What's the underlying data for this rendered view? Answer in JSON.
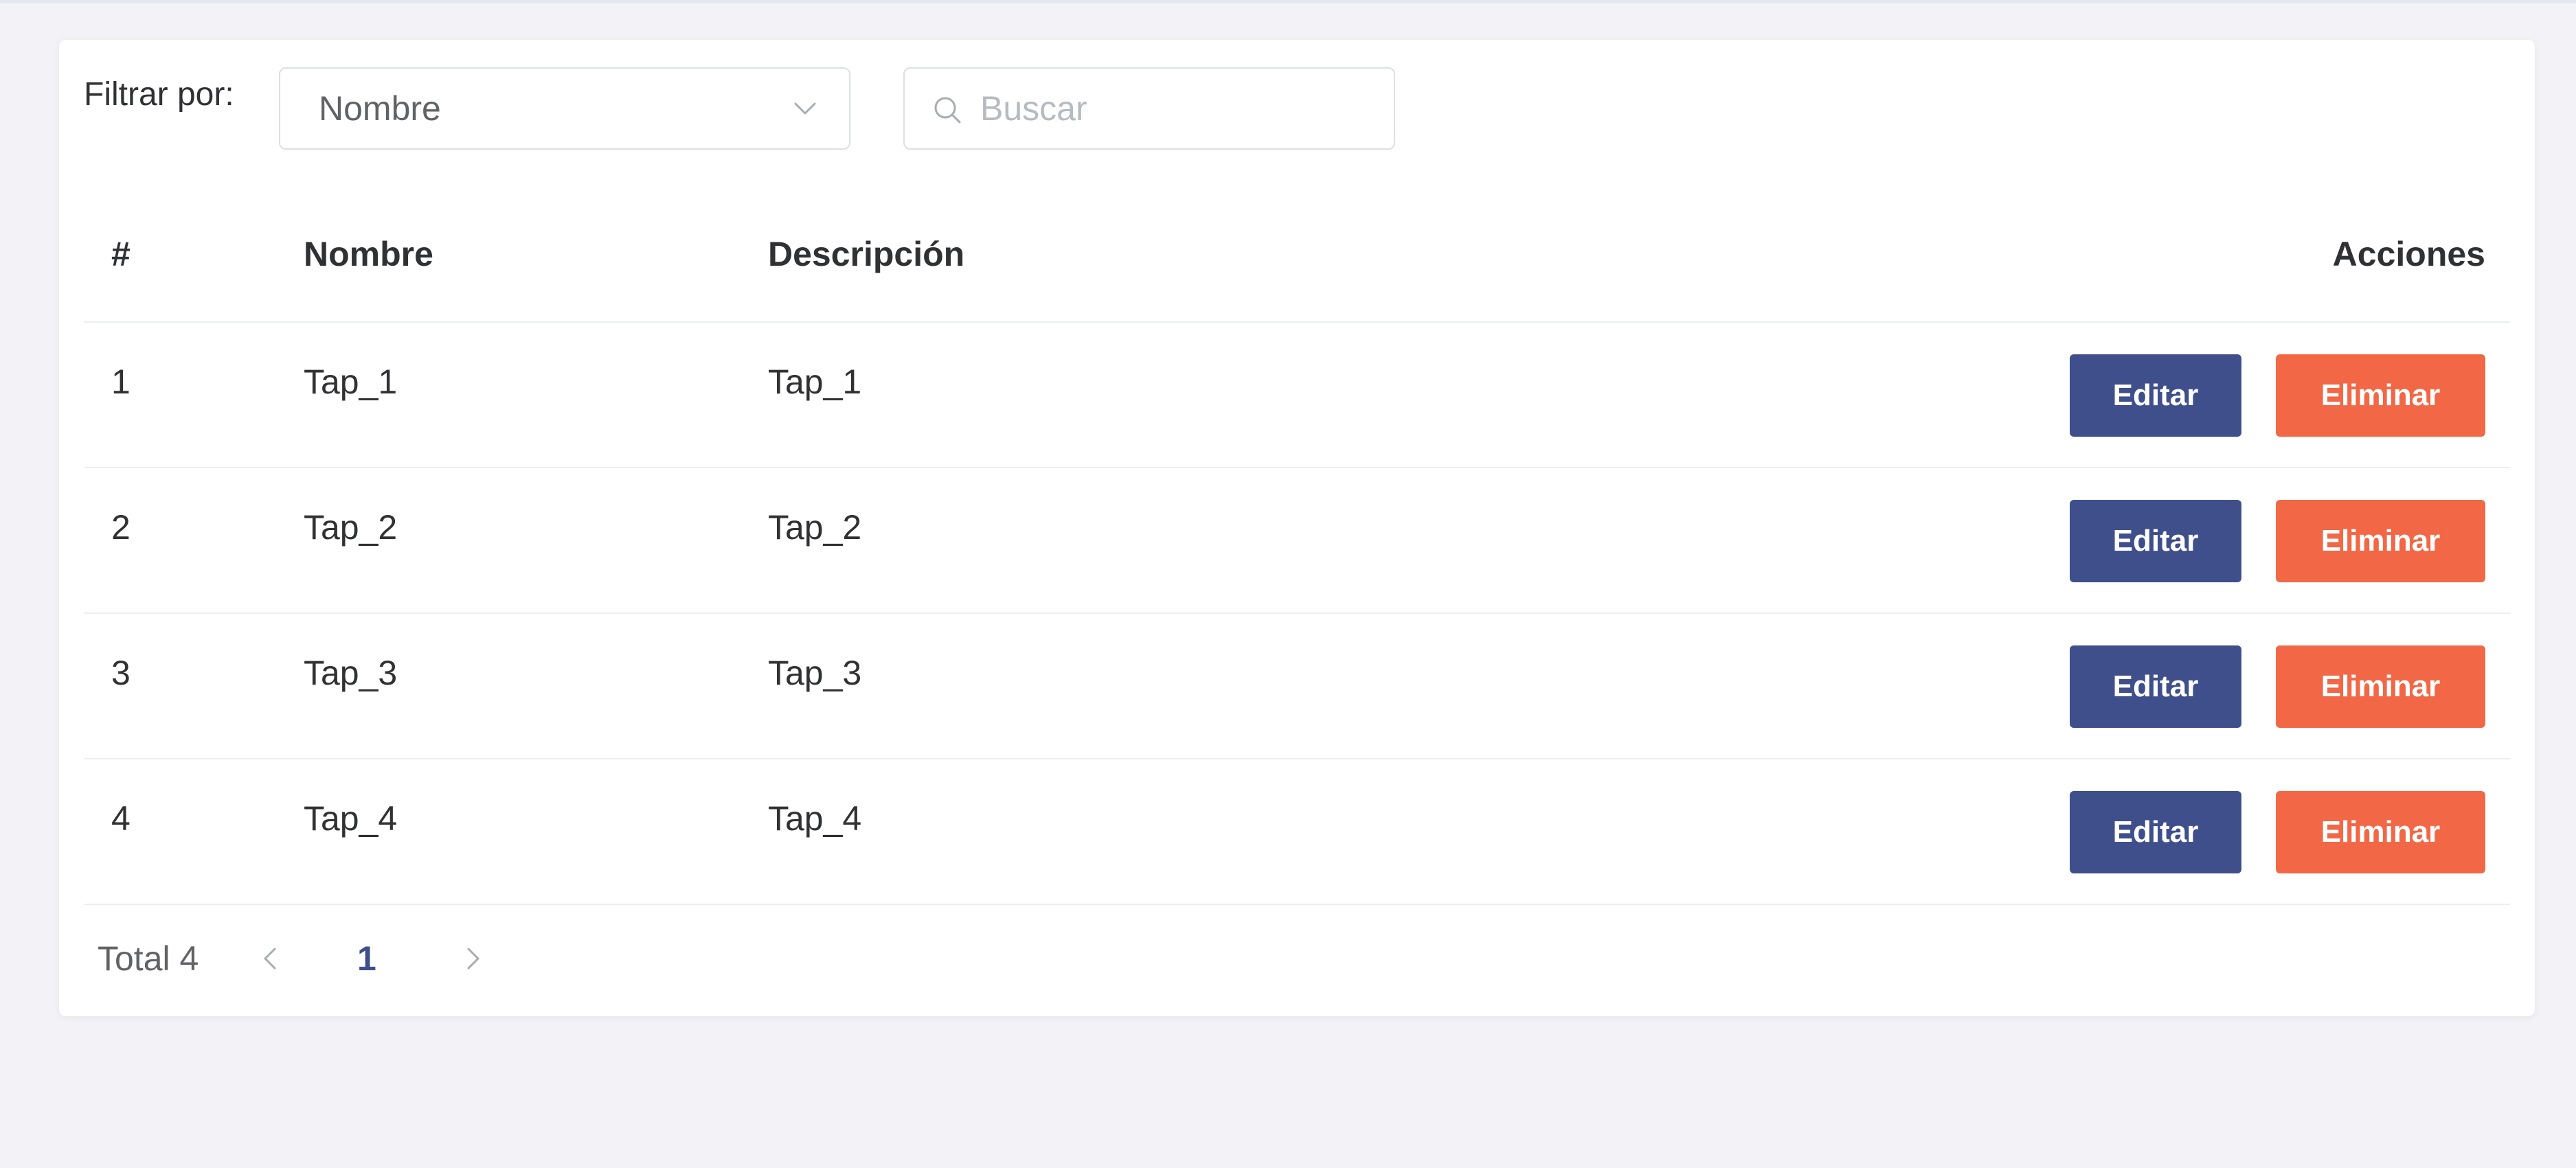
{
  "filter": {
    "label": "Filtrar por:",
    "selected": "Nombre",
    "search_placeholder": "Buscar"
  },
  "table": {
    "headers": {
      "num": "#",
      "name": "Nombre",
      "description": "Descripción",
      "actions": "Acciones"
    },
    "rows": [
      {
        "num": "1",
        "name": "Tap_1",
        "description": "Tap_1"
      },
      {
        "num": "2",
        "name": "Tap_2",
        "description": "Tap_2"
      },
      {
        "num": "3",
        "name": "Tap_3",
        "description": "Tap_3"
      },
      {
        "num": "4",
        "name": "Tap_4",
        "description": "Tap_4"
      }
    ],
    "edit_label": "Editar",
    "delete_label": "Eliminar"
  },
  "pagination": {
    "total": "Total 4",
    "current_page": "1"
  },
  "colors": {
    "edit_button": "#3f4f8c",
    "delete_button": "#f26846",
    "page_background": "#f2f2f7"
  },
  "icons": {
    "select": "chevron-down-icon",
    "search": "search-icon",
    "prev": "chevron-left-icon",
    "next": "chevron-right-icon"
  }
}
